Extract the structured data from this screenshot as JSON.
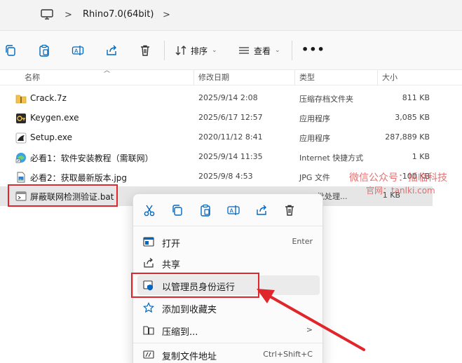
{
  "address": {
    "separator": ">",
    "folder": "Rhino7.0(64bit)",
    "trail_separator": ">"
  },
  "toolbar": {
    "sort_label": "排序",
    "view_label": "查看",
    "more_label": "•••"
  },
  "columns": {
    "name": "名称",
    "date": "修改日期",
    "type": "类型",
    "size": "大小"
  },
  "files": [
    {
      "name": "Crack.7z",
      "date": "2025/9/14 2:08",
      "type": "压缩存档文件夹",
      "size": "811 KB",
      "icon": "zip-folder-icon"
    },
    {
      "name": "Keygen.exe",
      "date": "2025/6/17 12:57",
      "type": "应用程序",
      "size": "3,085 KB",
      "icon": "keygen-app-icon"
    },
    {
      "name": "Setup.exe",
      "date": "2020/11/12 8:41",
      "type": "应用程序",
      "size": "287,889 KB",
      "icon": "rhino-setup-icon"
    },
    {
      "name": "必看1：软件安装教程（需联网）",
      "date": "2025/9/14 11:35",
      "type": "Internet 快捷方式",
      "size": "1 KB",
      "icon": "internet-shortcut-icon"
    },
    {
      "name": "必看2：获取最新版本.jpg",
      "date": "2025/9/8 4:53",
      "type": "JPG 文件",
      "size": "100 KB",
      "icon": "image-file-icon"
    },
    {
      "name": "屏蔽联网检测验证.bat",
      "date": "",
      "type": "ows 批处理...",
      "size": "1 KB",
      "icon": "batch-file-icon"
    }
  ],
  "watermark": {
    "line1": "微信公众号：插临科技",
    "line2": "官网：tanlki.com"
  },
  "context_menu": {
    "items": [
      {
        "label": "打开",
        "shortcut": "Enter"
      },
      {
        "label": "共享",
        "shortcut": ""
      },
      {
        "label": "以管理员身份运行",
        "shortcut": ""
      },
      {
        "label": "添加到收藏夹",
        "shortcut": ""
      },
      {
        "label": "压缩到...",
        "shortcut": ">"
      },
      {
        "label": "复制文件地址",
        "shortcut": "Ctrl+Shift+C"
      }
    ]
  },
  "colors": {
    "highlight_red": "#e0262b",
    "accent_blue": "#0067c0"
  }
}
